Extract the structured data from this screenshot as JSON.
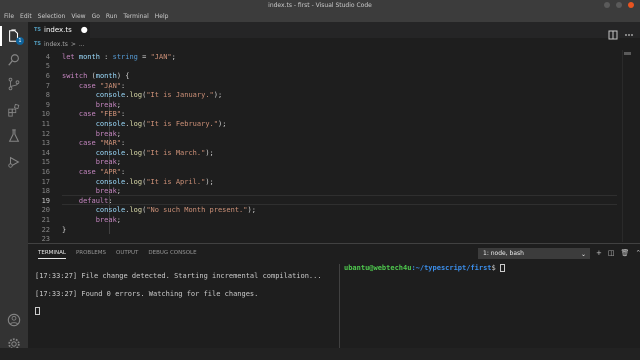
{
  "window": {
    "title": "index.ts - first - Visual Studio Code"
  },
  "menu": [
    "File",
    "Edit",
    "Selection",
    "View",
    "Go",
    "Run",
    "Terminal",
    "Help"
  ],
  "activity_bar": {
    "explorer_badge": "1"
  },
  "tabs": [
    {
      "label": "index.ts",
      "badge": "TS",
      "dirty_marker": "●"
    }
  ],
  "breadcrumb": {
    "file": "index.ts",
    "separator": ">",
    "more": "..."
  },
  "editor": {
    "lines": [
      {
        "n": "4",
        "t": "let month : string = \"JAN\";"
      },
      {
        "n": "5",
        "t": ""
      },
      {
        "n": "6",
        "t": "switch (month) {"
      },
      {
        "n": "7",
        "t": "    case \"JAN\":"
      },
      {
        "n": "8",
        "t": "        console.log(\"It is January.\");"
      },
      {
        "n": "9",
        "t": "        break;"
      },
      {
        "n": "10",
        "t": "    case \"FEB\":"
      },
      {
        "n": "11",
        "t": "        console.log(\"It is February.\");"
      },
      {
        "n": "12",
        "t": "        break;"
      },
      {
        "n": "13",
        "t": "    case \"MAR\":"
      },
      {
        "n": "14",
        "t": "        console.log(\"It is March.\");"
      },
      {
        "n": "15",
        "t": "        break;"
      },
      {
        "n": "16",
        "t": "    case \"APR\":"
      },
      {
        "n": "17",
        "t": "        console.log(\"It is April.\");"
      },
      {
        "n": "18",
        "t": "        break;"
      },
      {
        "n": "19",
        "t": "    default:"
      },
      {
        "n": "20",
        "t": "        console.log(\"No such Month present.\");"
      },
      {
        "n": "21",
        "t": "        break;"
      },
      {
        "n": "22",
        "t": "}"
      },
      {
        "n": "23",
        "t": ""
      }
    ]
  },
  "panel": {
    "tabs": [
      "TERMINAL",
      "PROBLEMS",
      "OUTPUT",
      "DEBUG CONSOLE"
    ],
    "active_tab": "TERMINAL",
    "terminal_select": "1: node, bash",
    "left_terminal": {
      "line1": "[17:33:27] File change detected. Starting incremental compilation...",
      "line2": "[17:33:27] Found 0 errors. Watching for file changes."
    },
    "right_terminal": {
      "user_host": "ubantu@webtech4u",
      "path": ":~/typescript/first",
      "prompt_symbol": "$"
    }
  },
  "colors": {
    "accent": "#0e639c",
    "keyword": "#c586c0",
    "string": "#ce9178",
    "function": "#dcdcaa",
    "prompt_user": "#4ec94e",
    "prompt_path": "#3b8eea"
  }
}
